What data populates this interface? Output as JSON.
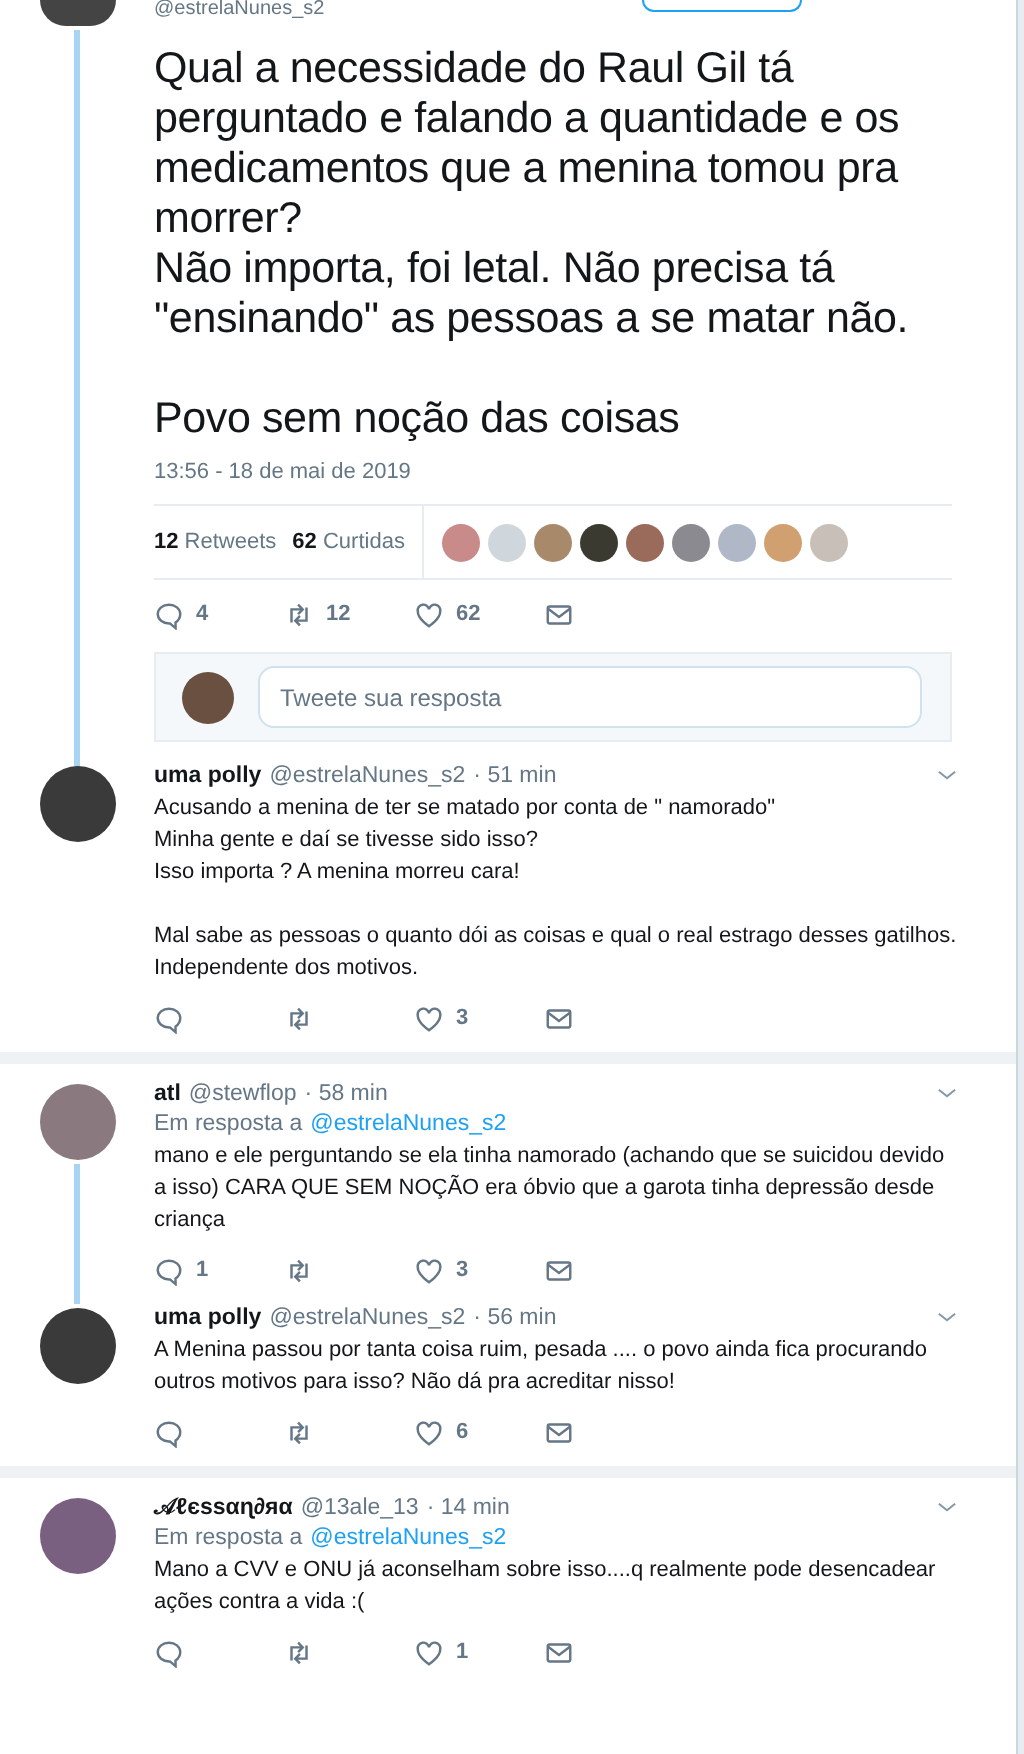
{
  "main_tweet": {
    "handle": "@estrelaNunes_s2",
    "text": "Qual a necessidade do Raul Gil tá perguntado e falando a quantidade e os medicamentos que a menina tomou pra morrer?\nNão importa, foi letal. Não precisa tá \"ensinando\" as pessoas a se matar não.\n\nPovo sem noção das coisas",
    "timestamp": "13:56 - 18 de mai de 2019",
    "stats": [
      {
        "count": "12",
        "label": "Retweets"
      },
      {
        "count": "62",
        "label": "Curtidas"
      }
    ],
    "actions": {
      "replies": "4",
      "retweets": "12",
      "likes": "62"
    }
  },
  "reply_box": {
    "placeholder": "Tweete sua resposta"
  },
  "conversations": [
    [
      {
        "name": "uma polly",
        "handle": "@estrelaNunes_s2",
        "time": "· 51 min",
        "text": "Acusando a menina de ter se matado por conta de \" namorado\"\nMinha gente e daí se tivesse sido isso?\nIsso importa ? A menina morreu cara!\n\nMal sabe as pessoas o quanto dói as coisas e qual o real estrago desses gatilhos. Independente dos motivos.",
        "actions": {
          "likes": "3"
        }
      }
    ],
    [
      {
        "name": "atl",
        "handle": "@stewflop",
        "time": "· 58 min",
        "reply_to_label": "Em resposta a",
        "reply_to_handle": "@estrelaNunes_s2",
        "text": "mano e ele perguntando se ela tinha namorado (achando que se suicidou devido a isso) CARA QUE SEM NOÇÃO era óbvio que a garota tinha depressão desde criança",
        "actions": {
          "replies": "1",
          "likes": "3"
        }
      },
      {
        "name": "uma polly",
        "handle": "@estrelaNunes_s2",
        "time": "· 56 min",
        "text": "A Menina passou por tanta coisa ruim, pesada .... o povo ainda fica procurando outros motivos para isso? Não dá pra acreditar nisso!",
        "actions": {
          "likes": "6"
        }
      }
    ],
    [
      {
        "name": "𝒜ℓєѕѕαɳ∂яα",
        "handle": "@13ale_13",
        "time": "· 14 min",
        "reply_to_label": "Em resposta a",
        "reply_to_handle": "@estrelaNunes_s2",
        "text": "Mano a CVV e ONU já aconselham sobre isso....q realmente pode desencadear ações contra a vida :(",
        "actions": {
          "likes": "1"
        }
      }
    ]
  ]
}
